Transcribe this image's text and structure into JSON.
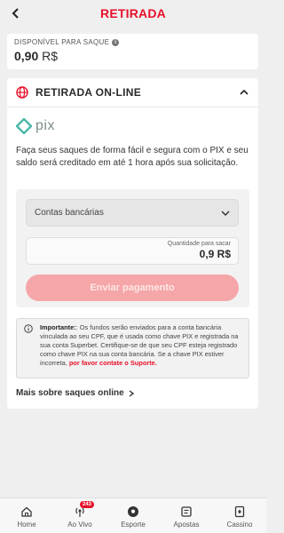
{
  "header": {
    "title": "RETIRADA"
  },
  "balance": {
    "label": "DISPONÍVEL PARA SAQUE",
    "amount": "0,90",
    "currency": "R$"
  },
  "section": {
    "title": "RETIRADA ON-LINE",
    "logo_text": "pix",
    "description": "Faça seus saques de forma fácil e segura com o PIX e seu saldo será creditado em até 1 hora após sua solicitação."
  },
  "form": {
    "account_select": "Contas bancárias",
    "amount_label": "Quantidade para sacar",
    "amount_value": "0,9 R$",
    "submit_label": "Enviar pagamento"
  },
  "notice": {
    "bold": "Importante:",
    "text": ": Os fundos serão enviados para a conta bancária vinculada ao seu CPF, que é usada como chave PIX e registrada na sua conta Superbet. Certifique-se de que seu CPF esteja registrado como chave PIX na sua conta bancária. Se a chave PIX estiver incorreta,",
    "link": "por favor contate o Suporte."
  },
  "more_link": "Mais sobre saques online",
  "nav": {
    "items": [
      {
        "label": "Home",
        "icon": "home-icon"
      },
      {
        "label": "Ao Vivo",
        "icon": "live-icon",
        "badge": "243"
      },
      {
        "label": "Esporte",
        "icon": "soccer-ball-icon"
      },
      {
        "label": "Apostas",
        "icon": "betslip-icon"
      },
      {
        "label": "Cassino",
        "icon": "casino-card-icon"
      }
    ]
  },
  "colors": {
    "accent": "#e8102a",
    "button_disabled": "#f5a6a8"
  }
}
